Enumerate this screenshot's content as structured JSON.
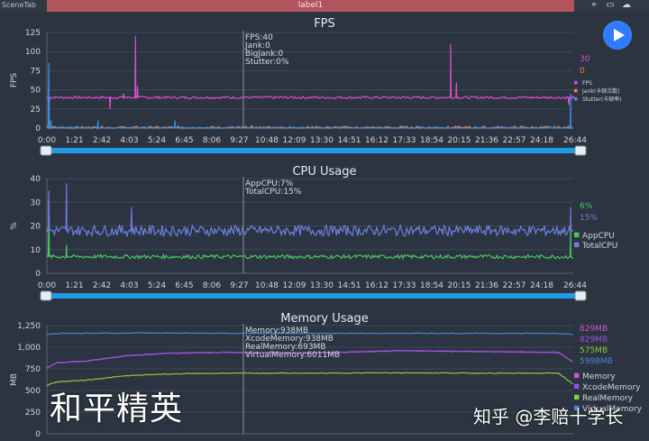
{
  "window": {
    "scene_tab": "SceneTab",
    "active_tab": "label1"
  },
  "overlay": {
    "game_title": "和平精英",
    "watermark": "知乎 @李赔十学长"
  },
  "colors": {
    "background": "#2b3440",
    "tab_active": "#b2545b",
    "slider": "#1f9ce6",
    "play": "#2f7bff"
  },
  "x_ticks": [
    "0:00",
    "1:21",
    "2:42",
    "4:03",
    "5:24",
    "6:45",
    "8:06",
    "9:27",
    "10:48",
    "12:09",
    "13:30",
    "14:51",
    "16:12",
    "17:33",
    "18:54",
    "20:15",
    "21:36",
    "22:57",
    "24:18",
    "26:44"
  ],
  "chart_data": [
    {
      "type": "line",
      "title": "FPS",
      "ylabel": "FPS",
      "ylim": [
        0,
        125
      ],
      "y_ticks": [
        "125",
        "100",
        "75",
        "50",
        "25",
        "0"
      ],
      "cursor_readout": [
        "FPS:40",
        "Jank:0",
        "BigJank:0",
        "Stutter:0%"
      ],
      "current_values": [
        "30",
        "0"
      ],
      "legend": [
        "FPS",
        "Jank(卡顿次数)",
        "Stutter(卡顿率)"
      ],
      "series": [
        {
          "name": "FPS",
          "color": "#d84fd0",
          "base": 40,
          "spikes": [
            [
              0.1,
              15
            ],
            [
              3.2,
              25
            ],
            [
              3.9,
              45
            ],
            [
              4.5,
              120
            ],
            [
              4.6,
              55
            ],
            [
              20.5,
              110
            ],
            [
              20.8,
              60
            ],
            [
              26.5,
              30
            ],
            [
              26.8,
              40
            ]
          ]
        },
        {
          "name": "Jank(卡顿次数)",
          "color": "#ff7a3c",
          "base": 0
        },
        {
          "name": "Stutter(卡顿率)",
          "color": "#3b8fe6",
          "base": 0,
          "spikes": [
            [
              0.1,
              85
            ],
            [
              0.2,
              10
            ],
            [
              2.6,
              10
            ],
            [
              6.5,
              10
            ],
            [
              26.6,
              45
            ]
          ]
        }
      ]
    },
    {
      "type": "line",
      "title": "CPU Usage",
      "ylabel": "%",
      "ylim": [
        0,
        40
      ],
      "y_ticks": [
        "40",
        "30",
        "20",
        "10",
        "0"
      ],
      "cursor_readout": [
        "AppCPU:7%",
        "TotalCPU:15%"
      ],
      "current_values": [
        "6%",
        "15%"
      ],
      "legend": [
        "AppCPU",
        "TotalCPU"
      ],
      "series": [
        {
          "name": "AppCPU",
          "color": "#48c85a",
          "base": 7,
          "spikes": [
            [
              0.1,
              25
            ],
            [
              1.0,
              12
            ],
            [
              26.6,
              20
            ]
          ]
        },
        {
          "name": "TotalCPU",
          "color": "#6f7fe0",
          "base": 18,
          "spikes": [
            [
              0.1,
              35
            ],
            [
              1.0,
              38
            ],
            [
              4.3,
              28
            ],
            [
              26.6,
              28
            ]
          ]
        }
      ]
    },
    {
      "type": "line",
      "title": "Memory Usage",
      "ylabel": "MB",
      "ylim": [
        0,
        1250
      ],
      "y_ticks": [
        "1,250",
        "1,000",
        "750",
        "500",
        "250",
        "0"
      ],
      "cursor_readout": [
        "Memory:938MB",
        "XcodeMemory:938MB",
        "RealMemory:693MB",
        "VirtualMemory:6011MB"
      ],
      "current_values": [
        "829MB",
        "829MB",
        "575MB",
        "5998MB"
      ],
      "legend": [
        "Memory",
        "XcodeMemory",
        "RealMemory",
        "VirtualMemory"
      ],
      "series": [
        {
          "name": "VirtualMemory",
          "color": "#4a86d8",
          "points": [
            [
              0,
              1150
            ],
            [
              1,
              1160
            ],
            [
              5,
              1165
            ],
            [
              10,
              1160
            ],
            [
              26,
              1160
            ],
            [
              26.7,
              1150
            ]
          ]
        },
        {
          "name": "Memory",
          "color": "#d84fd0",
          "points": [
            [
              0,
              760
            ],
            [
              0.5,
              820
            ],
            [
              2,
              840
            ],
            [
              4,
              900
            ],
            [
              6,
              930
            ],
            [
              9,
              940
            ],
            [
              14,
              935
            ],
            [
              18,
              960
            ],
            [
              22,
              950
            ],
            [
              26,
              940
            ],
            [
              26.7,
              829
            ]
          ]
        },
        {
          "name": "XcodeMemory",
          "color": "#9b4fe0",
          "points": [
            [
              0,
              760
            ],
            [
              0.5,
              820
            ],
            [
              2,
              840
            ],
            [
              4,
              900
            ],
            [
              6,
              930
            ],
            [
              9,
              940
            ],
            [
              14,
              935
            ],
            [
              18,
              960
            ],
            [
              22,
              950
            ],
            [
              26,
              940
            ],
            [
              26.7,
              829
            ]
          ]
        },
        {
          "name": "RealMemory",
          "color": "#8ccc3a",
          "points": [
            [
              0,
              560
            ],
            [
              0.5,
              600
            ],
            [
              2,
              620
            ],
            [
              4,
              670
            ],
            [
              6,
              690
            ],
            [
              9,
              700
            ],
            [
              14,
              700
            ],
            [
              18,
              705
            ],
            [
              22,
              700
            ],
            [
              26,
              700
            ],
            [
              26.7,
              575
            ]
          ]
        }
      ]
    }
  ]
}
